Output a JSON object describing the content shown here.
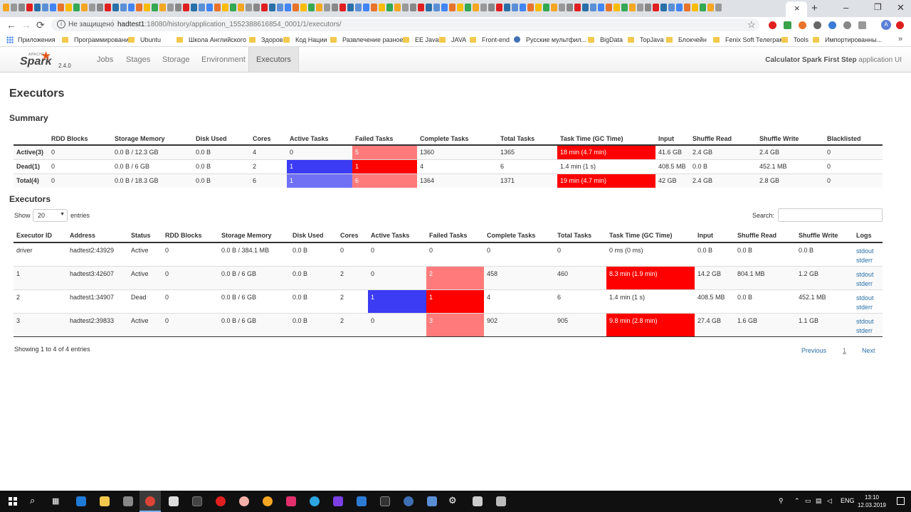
{
  "browser": {
    "address": {
      "insecure_label": "Не защищено",
      "url_host": "hadtest1",
      "url_path": ":18080/history/application_1552388616854_0001/1/executors/"
    },
    "bookmarks": {
      "apps_label": "Приложения",
      "items": [
        "Программирование",
        "Ubuntu",
        "Школа Английского",
        "Здоровье",
        "Код Нации",
        "Развлечение разное",
        "EE Java",
        "JAVA",
        "Front-end",
        "Русские мультфил...",
        "BigData",
        "TopJava",
        "Блокчейн",
        "Fenix Soft Телеграм",
        "Tools",
        "Импортированны..."
      ]
    },
    "profile_initial": "A"
  },
  "spark": {
    "brand": {
      "apache": "APACHE",
      "name": "Spark",
      "version": "2.4.0"
    },
    "nav_tabs": [
      "Jobs",
      "Stages",
      "Storage",
      "Environment",
      "Executors"
    ],
    "active_tab": "Executors",
    "app_name": "Calculator Spark First Step",
    "app_suffix": "application UI"
  },
  "page_title": "Executors",
  "summary": {
    "heading": "Summary",
    "columns": [
      "",
      "RDD Blocks",
      "Storage Memory",
      "Disk Used",
      "Cores",
      "Active Tasks",
      "Failed Tasks",
      "Complete Tasks",
      "Total Tasks",
      "Task Time (GC Time)",
      "Input",
      "Shuffle Read",
      "Shuffle Write",
      "Blacklisted"
    ],
    "rows": [
      [
        "Active(3)",
        "0",
        "0.0 B / 12.3 GB",
        "0.0 B",
        "4",
        "0",
        "5",
        "1360",
        "1365",
        "18 min (4.7 min)",
        "41.6 GB",
        "2.4 GB",
        "2.4 GB",
        "0"
      ],
      [
        "Dead(1)",
        "0",
        "0.0 B / 6 GB",
        "0.0 B",
        "2",
        "1",
        "1",
        "4",
        "6",
        "1.4 min (1 s)",
        "408.5 MB",
        "0.0 B",
        "452.1 MB",
        "0"
      ],
      [
        "Total(4)",
        "0",
        "0.0 B / 18.3 GB",
        "0.0 B",
        "6",
        "1",
        "6",
        "1364",
        "1371",
        "19 min (4.7 min)",
        "42 GB",
        "2.4 GB",
        "2.8 GB",
        "0"
      ]
    ]
  },
  "executors": {
    "heading": "Executors",
    "show_label": "Show",
    "entries_value": "20",
    "entries_label": "entries",
    "search_label": "Search:",
    "search_value": "",
    "columns": [
      "Executor ID",
      "Address",
      "Status",
      "RDD Blocks",
      "Storage Memory",
      "Disk Used",
      "Cores",
      "Active Tasks",
      "Failed Tasks",
      "Complete Tasks",
      "Total Tasks",
      "Task Time (GC Time)",
      "Input",
      "Shuffle Read",
      "Shuffle Write",
      "Logs"
    ],
    "rows": [
      [
        "driver",
        "hadtest2:43929",
        "Active",
        "0",
        "0.0 B / 384.1 MB",
        "0.0 B",
        "0",
        "0",
        "0",
        "0",
        "0",
        "0 ms (0 ms)",
        "0.0 B",
        "0.0 B",
        "0.0 B"
      ],
      [
        "1",
        "hadtest3:42607",
        "Active",
        "0",
        "0.0 B / 6 GB",
        "0.0 B",
        "2",
        "0",
        "2",
        "458",
        "460",
        "8.3 min (1.9 min)",
        "14.2 GB",
        "804.1 MB",
        "1.2 GB"
      ],
      [
        "2",
        "hadtest1:34907",
        "Dead",
        "0",
        "0.0 B / 6 GB",
        "0.0 B",
        "2",
        "1",
        "1",
        "4",
        "6",
        "1.4 min (1 s)",
        "408.5 MB",
        "0.0 B",
        "452.1 MB"
      ],
      [
        "3",
        "hadtest2:39833",
        "Active",
        "0",
        "0.0 B / 6 GB",
        "0.0 B",
        "2",
        "0",
        "3",
        "902",
        "905",
        "9.8 min (2.8 min)",
        "27.4 GB",
        "1.6 GB",
        "1.1 GB"
      ]
    ],
    "log_links": [
      "stdout",
      "stderr"
    ],
    "showing_text": "Showing 1 to 4 of 4 entries",
    "pagination": {
      "previous": "Previous",
      "page": "1",
      "next": "Next"
    }
  },
  "taskbar": {
    "language": "ENG",
    "time": "13:10",
    "date": "12.03.2019"
  },
  "colors": {
    "failed_dark": "#ff0000",
    "failed_light": "#ff7b7b",
    "active_dark": "#3c3cf5",
    "active_light": "#7070f5",
    "spark_orange": "#e25a1c",
    "link": "#2a6fa8"
  }
}
